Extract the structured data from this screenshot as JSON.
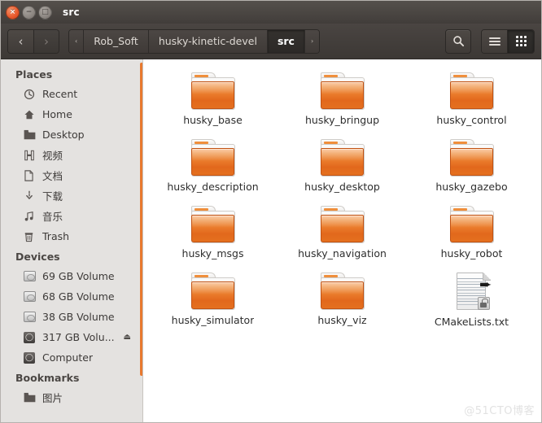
{
  "window": {
    "title": "src",
    "controls": [
      {
        "name": "close",
        "glyph": "×"
      },
      {
        "name": "minimize",
        "glyph": "−"
      },
      {
        "name": "maximize",
        "glyph": "□"
      }
    ]
  },
  "toolbar": {
    "back_glyph": "‹",
    "forward_glyph": "›",
    "breadcrumbs": [
      {
        "label": "‹",
        "active": false,
        "tiny": true
      },
      {
        "label": "Rob_Soft",
        "active": false,
        "tiny": false
      },
      {
        "label": "husky-kinetic-devel",
        "active": false,
        "tiny": false
      },
      {
        "label": "src",
        "active": true,
        "tiny": false
      },
      {
        "label": "›",
        "active": false,
        "tiny": true
      }
    ],
    "search_label": "⌕",
    "view_list_label": "list-view",
    "view_grid_label": "grid-view"
  },
  "sidebar": {
    "sections": [
      {
        "heading": "Places",
        "items": [
          {
            "label": "Recent",
            "icon": "clock-icon",
            "glyph": "◷",
            "eject": false
          },
          {
            "label": "Home",
            "icon": "home-icon",
            "glyph": "⌂",
            "eject": false
          },
          {
            "label": "Desktop",
            "icon": "folder-icon",
            "glyph": "▰",
            "eject": false
          },
          {
            "label": "视频",
            "icon": "video-icon",
            "glyph": "░",
            "eject": false
          },
          {
            "label": "文档",
            "icon": "document-icon",
            "glyph": "☐",
            "eject": false
          },
          {
            "label": "下载",
            "icon": "download-icon",
            "glyph": "↓",
            "eject": false
          },
          {
            "label": "音乐",
            "icon": "music-icon",
            "glyph": "♫",
            "eject": false
          },
          {
            "label": "Trash",
            "icon": "trash-icon",
            "glyph": "Ὕ1",
            "eject": false
          }
        ]
      },
      {
        "heading": "Devices",
        "items": [
          {
            "label": "69 GB Volume",
            "icon": "hard-drive-icon",
            "glyph": "",
            "eject": false
          },
          {
            "label": "68 GB Volume",
            "icon": "hard-drive-icon",
            "glyph": "",
            "eject": false
          },
          {
            "label": "38 GB Volume",
            "icon": "hard-drive-icon",
            "glyph": "",
            "eject": false
          },
          {
            "label": "317 GB Volu...",
            "icon": "disk-icon",
            "glyph": "",
            "eject": true
          },
          {
            "label": "Computer",
            "icon": "computer-icon",
            "glyph": "",
            "eject": false
          }
        ]
      },
      {
        "heading": "Bookmarks",
        "items": [
          {
            "label": "图片",
            "icon": "folder-icon",
            "glyph": "▰",
            "eject": false
          }
        ]
      }
    ],
    "eject_glyph": "⏏"
  },
  "main": {
    "items": [
      {
        "name": "husky_base",
        "type": "folder"
      },
      {
        "name": "husky_bringup",
        "type": "folder"
      },
      {
        "name": "husky_control",
        "type": "folder"
      },
      {
        "name": "husky_description",
        "type": "folder"
      },
      {
        "name": "husky_desktop",
        "type": "folder"
      },
      {
        "name": "husky_gazebo",
        "type": "folder"
      },
      {
        "name": "husky_msgs",
        "type": "folder"
      },
      {
        "name": "husky_navigation",
        "type": "folder"
      },
      {
        "name": "husky_robot",
        "type": "folder"
      },
      {
        "name": "husky_simulator",
        "type": "folder"
      },
      {
        "name": "husky_viz",
        "type": "folder"
      },
      {
        "name": "CMakeLists.txt",
        "type": "document-locked"
      }
    ]
  },
  "watermark": "@51CTO博客",
  "colors": {
    "accent_orange": "#e8792f",
    "titlebar_dark": "#413d3a",
    "sidebar_bg": "#e4e2e0",
    "main_bg": "#ffffff"
  }
}
